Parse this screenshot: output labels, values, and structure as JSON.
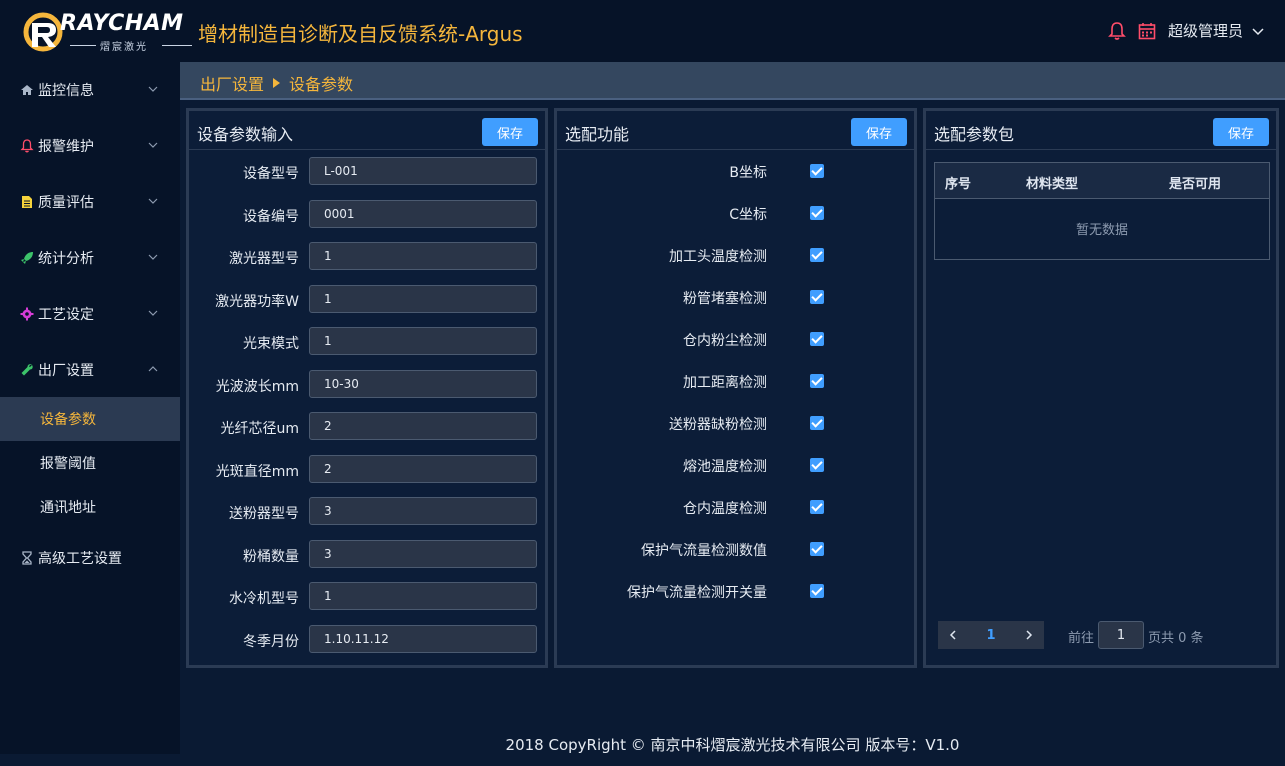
{
  "header": {
    "logo_text": "RAYCHAM",
    "logo_sub": "熠宸激光",
    "app_title": "增材制造自诊断及自反馈系统-Argus",
    "user_name": "超级管理员",
    "icons": [
      "bell-icon",
      "calendar-icon",
      "chevron-down-icon"
    ],
    "colors": {
      "title": "#f5b63c",
      "bell": "#ff4d6a",
      "calendar": "#ff4d6a"
    }
  },
  "sidebar": {
    "items": [
      {
        "label": "监控信息",
        "icon": "home-icon"
      },
      {
        "label": "报警维护",
        "icon": "bell-icon"
      },
      {
        "label": "质量评估",
        "icon": "document-icon"
      },
      {
        "label": "统计分析",
        "icon": "rocket-icon"
      },
      {
        "label": "工艺设定",
        "icon": "gear-icon"
      },
      {
        "label": "出厂设置",
        "icon": "wrench-icon"
      },
      {
        "label": "高级工艺设置",
        "icon": "hourglass-icon"
      }
    ],
    "subitems": [
      {
        "label": "设备参数",
        "active": true
      },
      {
        "label": "报警阈值",
        "active": false
      },
      {
        "label": "通讯地址",
        "active": false
      }
    ]
  },
  "breadcrumb": {
    "parent": "出厂设置",
    "current": "设备参数"
  },
  "device_panel": {
    "title": "设备参数输入",
    "save_label": "保存",
    "fields": [
      {
        "label": "设备型号",
        "value": "L-001"
      },
      {
        "label": "设备编号",
        "value": "0001"
      },
      {
        "label": "激光器型号",
        "value": "1"
      },
      {
        "label": "激光器功率W",
        "value": "1"
      },
      {
        "label": "光束模式",
        "value": "1"
      },
      {
        "label": "光波波长mm",
        "value": "10-30"
      },
      {
        "label": "光纤芯径um",
        "value": "2"
      },
      {
        "label": "光斑直径mm",
        "value": "2"
      },
      {
        "label": "送粉器型号",
        "value": "3"
      },
      {
        "label": "粉桶数量",
        "value": "3"
      },
      {
        "label": "水冷机型号",
        "value": "1"
      },
      {
        "label": "冬季月份",
        "value": "1.10.11.12"
      }
    ]
  },
  "options_panel": {
    "title": "选配功能",
    "save_label": "保存",
    "options": [
      {
        "label": "B坐标",
        "checked": true
      },
      {
        "label": "C坐标",
        "checked": true
      },
      {
        "label": "加工头温度检测",
        "checked": true
      },
      {
        "label": "粉管堵塞检测",
        "checked": true
      },
      {
        "label": "仓内粉尘检测",
        "checked": true
      },
      {
        "label": "加工距离检测",
        "checked": true
      },
      {
        "label": "送粉器缺粉检测",
        "checked": true
      },
      {
        "label": "熔池温度检测",
        "checked": true
      },
      {
        "label": "仓内温度检测",
        "checked": true
      },
      {
        "label": "保护气流量检测数值",
        "checked": true
      },
      {
        "label": "保护气流量检测开关量",
        "checked": true
      }
    ]
  },
  "package_panel": {
    "title": "选配参数包",
    "save_label": "保存",
    "columns": [
      "序号",
      "材料类型",
      "是否可用"
    ],
    "empty_text": "暂无数据",
    "pager": {
      "prev": "‹",
      "page": "1",
      "next": "›",
      "goto_label": "前往",
      "goto_value": "1",
      "total_text": "页共 0 条"
    }
  },
  "footer": {
    "text": "2018 CopyRight © 南京中科熠宸激光技术有限公司 版本号：V1.0"
  }
}
